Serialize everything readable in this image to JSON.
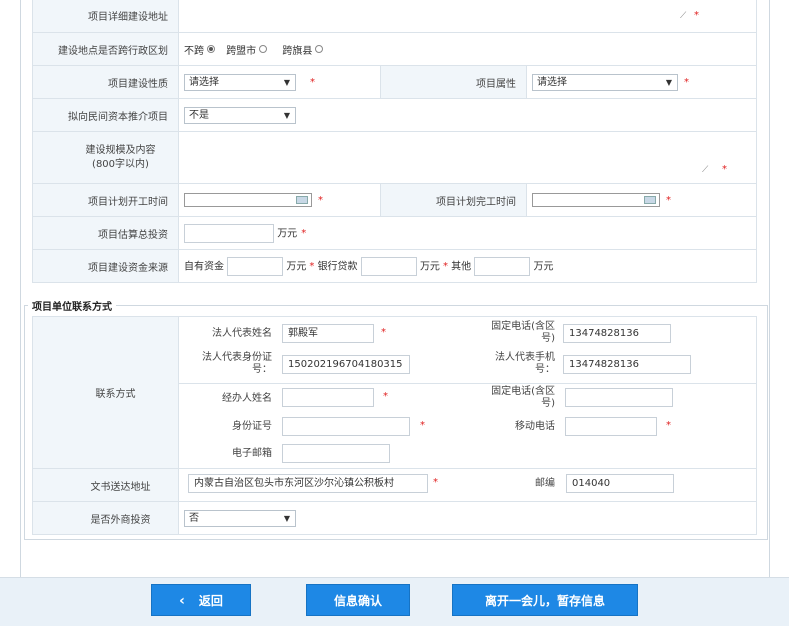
{
  "project": {
    "detail_address_label": "项目详细建设地址",
    "cross_region_label": "建设地点是否跨行政区划",
    "cross_options": [
      "不跨",
      "跨盟市",
      "跨旗县"
    ],
    "nature_label": "项目建设性质",
    "nature_value": "请选择",
    "attribute_label": "项目属性",
    "attribute_value": "请选择",
    "private_capital_label": "拟向民间资本推介项目",
    "private_capital_value": "不是",
    "scale_label_1": "建设规模及内容",
    "scale_label_2": "(800字以内)",
    "start_label": "项目计划开工时间",
    "end_label": "项目计划完工时间",
    "investment_label": "项目估算总投资",
    "unit_wan": "万元",
    "fund_source_label": "项目建设资金来源",
    "own_funds_label": "自有资金",
    "bank_loan_label": "银行贷款",
    "other_label": "其他",
    "required_mark": "*"
  },
  "contact": {
    "section_title": "项目单位联系方式",
    "contact_method_label": "联系方式",
    "legal_rep_name_label": "法人代表姓名",
    "legal_rep_name_value": "郭殿军",
    "fixed_phone_label_1": "固定电话(含区",
    "fixed_phone_label_2": "号)",
    "fixed_phone_value": "13474828136",
    "legal_id_label_1": "法人代表身份证",
    "legal_id_label_2": "号：",
    "legal_id_value": "150202196704180315",
    "legal_mobile_label_1": "法人代表手机",
    "legal_mobile_label_2": "号：",
    "legal_mobile_value": "13474828136",
    "handler_name_label": "经办人姓名",
    "handler_fixed_label_1": "固定电话(含区",
    "handler_fixed_label_2": "号)",
    "id_number_label": "身份证号",
    "mobile_label": "移动电话",
    "email_label": "电子邮箱",
    "delivery_address_label": "文书送达地址",
    "delivery_address_value": "内蒙古自治区包头市东河区沙尔沁镇公积板村",
    "postcode_label": "邮编",
    "postcode_value": "014040",
    "foreign_label": "是否外商投资",
    "foreign_value": "否"
  },
  "buttons": {
    "back": "返回",
    "back_icon": "chevron-left-icon",
    "confirm": "信息确认",
    "save_later": "离开一会儿，暂存信息"
  },
  "colors": {
    "button_blue": "#1e88e5",
    "label_bg": "#f1f6fa",
    "required_red": "#e02020"
  }
}
